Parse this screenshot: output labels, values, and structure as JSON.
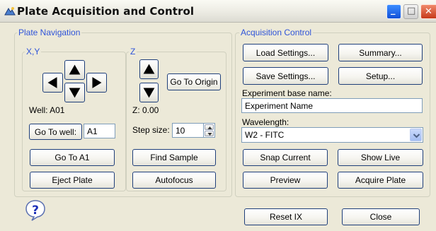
{
  "window": {
    "title": "Plate Acquisition and Control",
    "controls": {
      "minimize": "_",
      "maximize": "□",
      "close": "✕"
    }
  },
  "plate_navigation": {
    "group_title": "Plate Navigation",
    "xy": {
      "title": "X,Y",
      "well_label": "Well: A01",
      "go_to_well_label": "Go To well:",
      "well_value": "A1",
      "go_to_a1_label": "Go To A1",
      "eject_plate_label": "Eject Plate"
    },
    "z": {
      "title": "Z",
      "go_to_origin_label": "Go To Origin",
      "z_readout": "Z: 0.00",
      "step_size_label": "Step size:",
      "step_size_value": "10",
      "find_sample_label": "Find Sample",
      "autofocus_label": "Autofocus"
    }
  },
  "acquisition_control": {
    "group_title": "Acquisition Control",
    "load_settings_label": "Load Settings...",
    "summary_label": "Summary...",
    "save_settings_label": "Save Settings...",
    "setup_label": "Setup...",
    "experiment_base_name_label": "Experiment base name:",
    "experiment_base_name_value": "Experiment Name",
    "wavelength_label": "Wavelength:",
    "wavelength_value": "W2 - FITC",
    "snap_current_label": "Snap Current",
    "show_live_label": "Show Live",
    "preview_label": "Preview",
    "acquire_plate_label": "Acquire Plate"
  },
  "footer": {
    "help_icon": "question-mark-bubble-icon",
    "reset_ix_label": "Reset IX",
    "close_label": "Close"
  },
  "colors": {
    "window_background": "#ece9d8",
    "group_title": "#2f54d9",
    "button_border": "#1f3f7a",
    "close_red": "#c6391a",
    "minimize_blue": "#1150d8"
  }
}
